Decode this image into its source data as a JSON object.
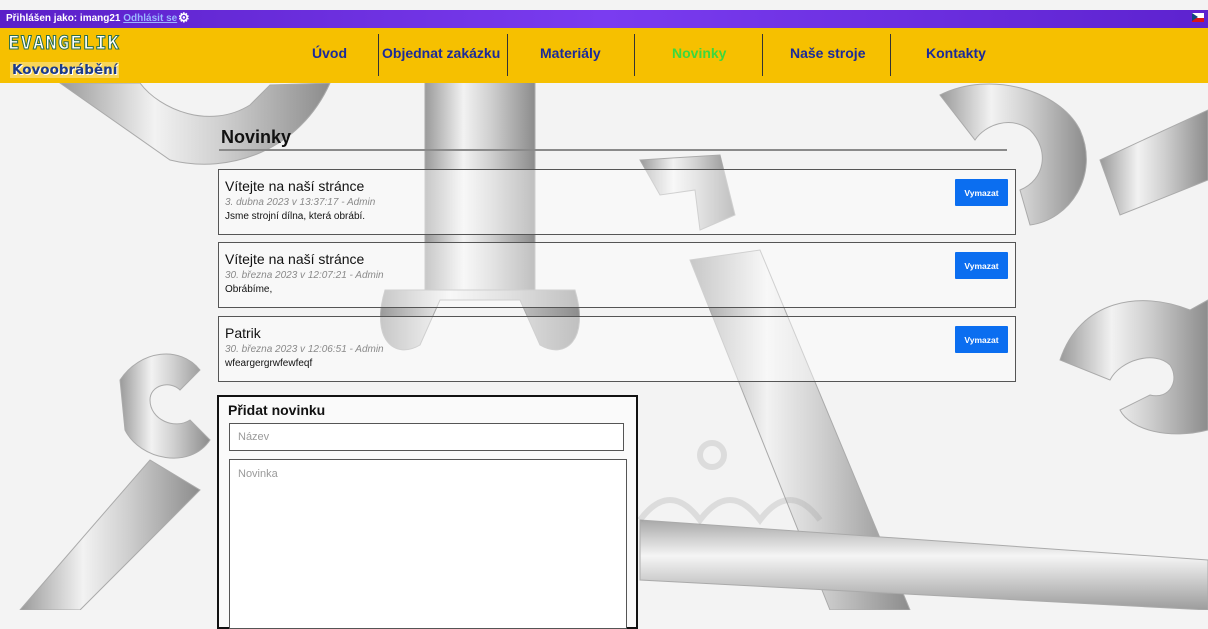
{
  "topbar": {
    "logged_in_label": "Přihlášen jako: imang21",
    "logout_label": "Odhlásit se",
    "settings_icon": "gear-icon",
    "language_icon": "czech-flag-icon"
  },
  "logo": {
    "line1": "EVANGELIK",
    "line2": "Kovoobrábění"
  },
  "nav": {
    "items": [
      {
        "label": "Úvod"
      },
      {
        "label": "Objednat zakázku"
      },
      {
        "label": "Materiály"
      },
      {
        "label": "Novinky",
        "active": true
      },
      {
        "label": "Naše stroje"
      },
      {
        "label": "Kontakty"
      }
    ]
  },
  "page": {
    "title": "Novinky"
  },
  "news": [
    {
      "title": "Vítejte na naší stránce",
      "meta": "3. dubna 2023 v 13:37:17 - Admin",
      "body": "Jsme strojní dílna, která obrábí.",
      "delete_label": "Vymazat"
    },
    {
      "title": "Vítejte na naší stránce",
      "meta": "30. března 2023 v 12:07:21 - Admin",
      "body": "Obrábíme,",
      "delete_label": "Vymazat"
    },
    {
      "title": "Patrik",
      "meta": "30. března 2023 v 12:06:51 - Admin",
      "body": "wfeargergrwfewfeqf",
      "delete_label": "Vymazat"
    }
  ],
  "add_form": {
    "heading": "Přidat novinku",
    "title_placeholder": "Název",
    "body_placeholder": "Novinka"
  },
  "colors": {
    "topbar": "#6a2ee0",
    "navbar": "#f6c000",
    "nav_link": "#1b2a9a",
    "nav_active": "#3dd83d",
    "delete_button": "#0b6ef0"
  }
}
